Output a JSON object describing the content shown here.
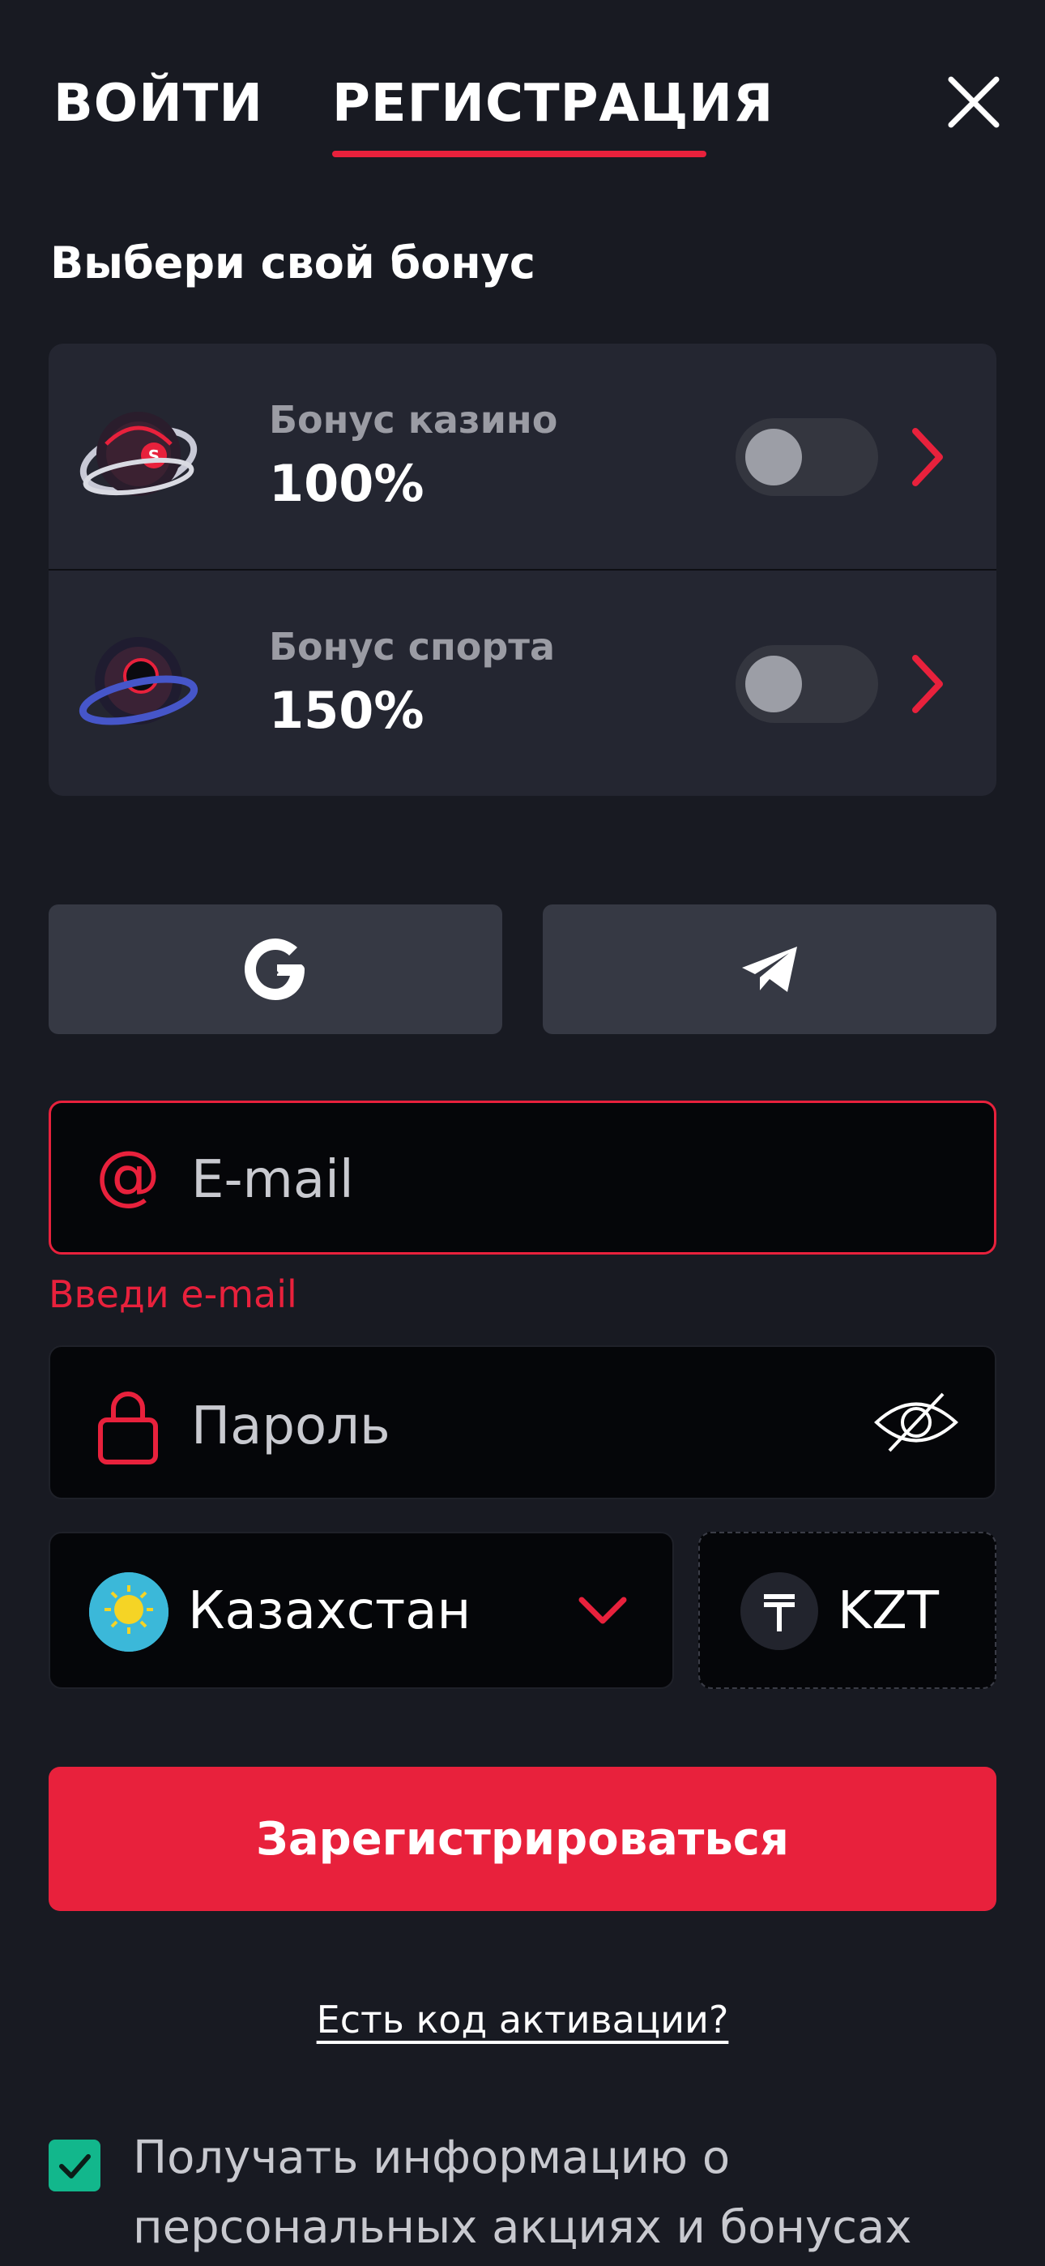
{
  "tabs": {
    "login_label": "ВОЙТИ",
    "register_label": "РЕГИСТРАЦИЯ",
    "active": "register"
  },
  "section_title": "Выбери свой бонус",
  "bonuses": [
    {
      "label": "Бонус казино",
      "value": "100%",
      "enabled": false,
      "image_icon": "casino-bonus-badge"
    },
    {
      "label": "Бонус спорта",
      "value": "150%",
      "enabled": false,
      "image_icon": "sport-bonus-badge"
    }
  ],
  "social": {
    "google_icon": "google-icon",
    "telegram_icon": "telegram-icon"
  },
  "form": {
    "email_placeholder": "E-mail",
    "email_error": "Введи e-mail",
    "password_placeholder": "Пароль",
    "country": "Казахстан",
    "currency": "KZT",
    "currency_symbol": "₸"
  },
  "register_button": "Зарегистрироваться",
  "activation_link": "Есть код активации?",
  "consent": {
    "checked": true,
    "text": "Получать информацию о персональных акциях и бонусах"
  },
  "colors": {
    "accent": "#e8213c",
    "background": "#181a22",
    "card": "#242631",
    "checkbox": "#12b78c"
  }
}
